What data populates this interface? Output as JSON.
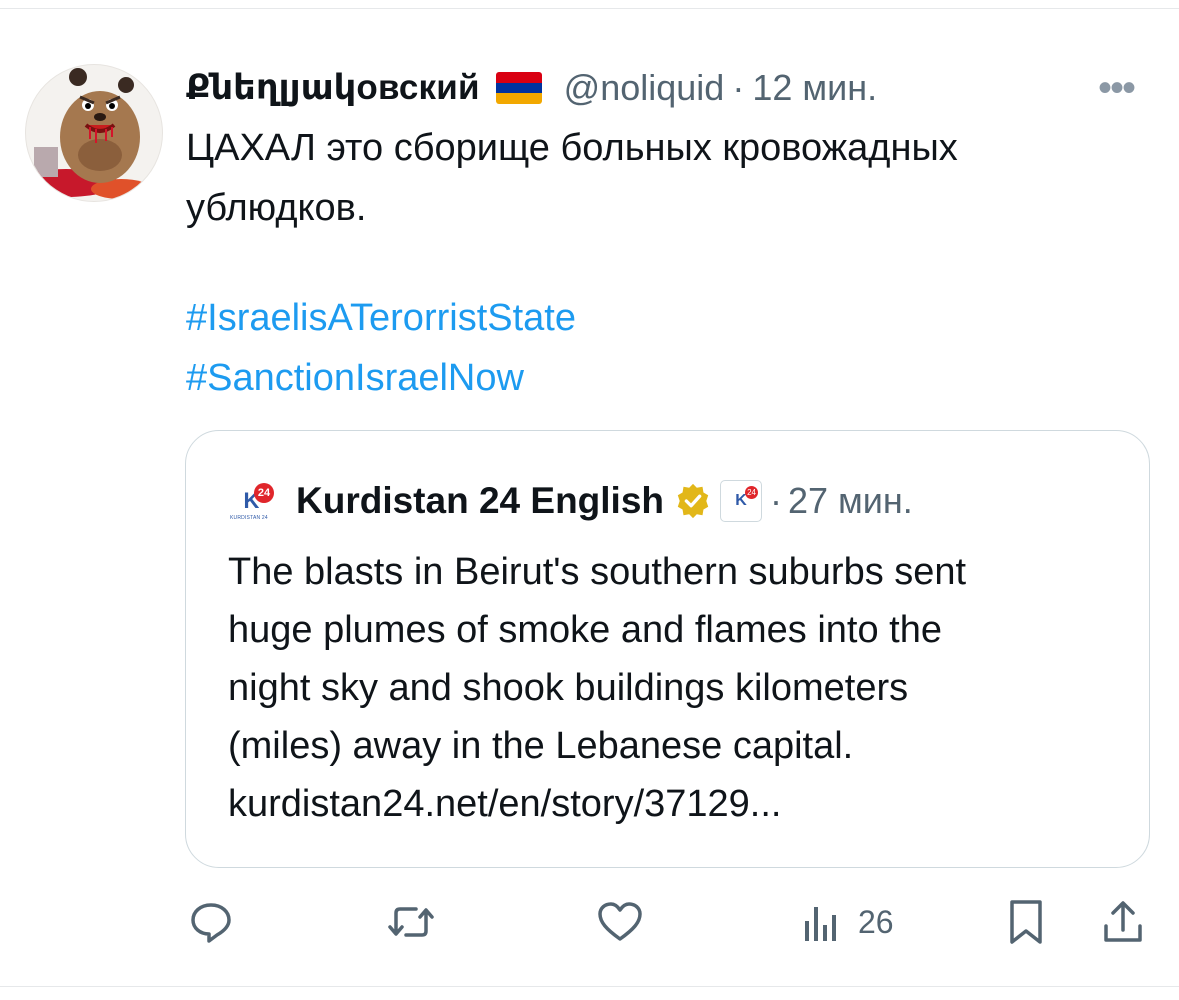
{
  "tweet": {
    "display_name": "Քնեղլյակовский",
    "handle": "@noliquid",
    "separator": "·",
    "time": "12 мин.",
    "more": "•••",
    "text": "ЦАХАЛ это сборище больных кровожадных\nублюдков.",
    "hashtags": [
      "#IsraelisATerorristState",
      "#SanctionIsraelNow"
    ]
  },
  "quote": {
    "name": "Kurdistan 24 English",
    "separator": "·",
    "time": "27 мин.",
    "logo_text": "K",
    "logo_num": "24",
    "logo_sub": "KURDISTAN 24",
    "text_lines": [
      "The blasts in Beirut's southern suburbs sent",
      "huge plumes of smoke and flames into the",
      "night sky and shook buildings kilometers",
      "(miles) away in the Lebanese capital.",
      "kurdistan24.net/en/story/37129..."
    ]
  },
  "actions": {
    "views_count": "26"
  },
  "icons": {
    "reply": "reply-icon",
    "retweet": "retweet-icon",
    "like": "heart-icon",
    "views": "bar-chart-icon",
    "bookmark": "bookmark-icon",
    "share": "share-icon",
    "verified": "verified-badge-icon",
    "flag": "armenia-flag-icon"
  },
  "colors": {
    "link": "#1d9bf0",
    "secondary_text": "#536471",
    "flag": [
      "#d90012",
      "#0033a0",
      "#f2a800"
    ],
    "verified_gold": "#e2b719"
  }
}
